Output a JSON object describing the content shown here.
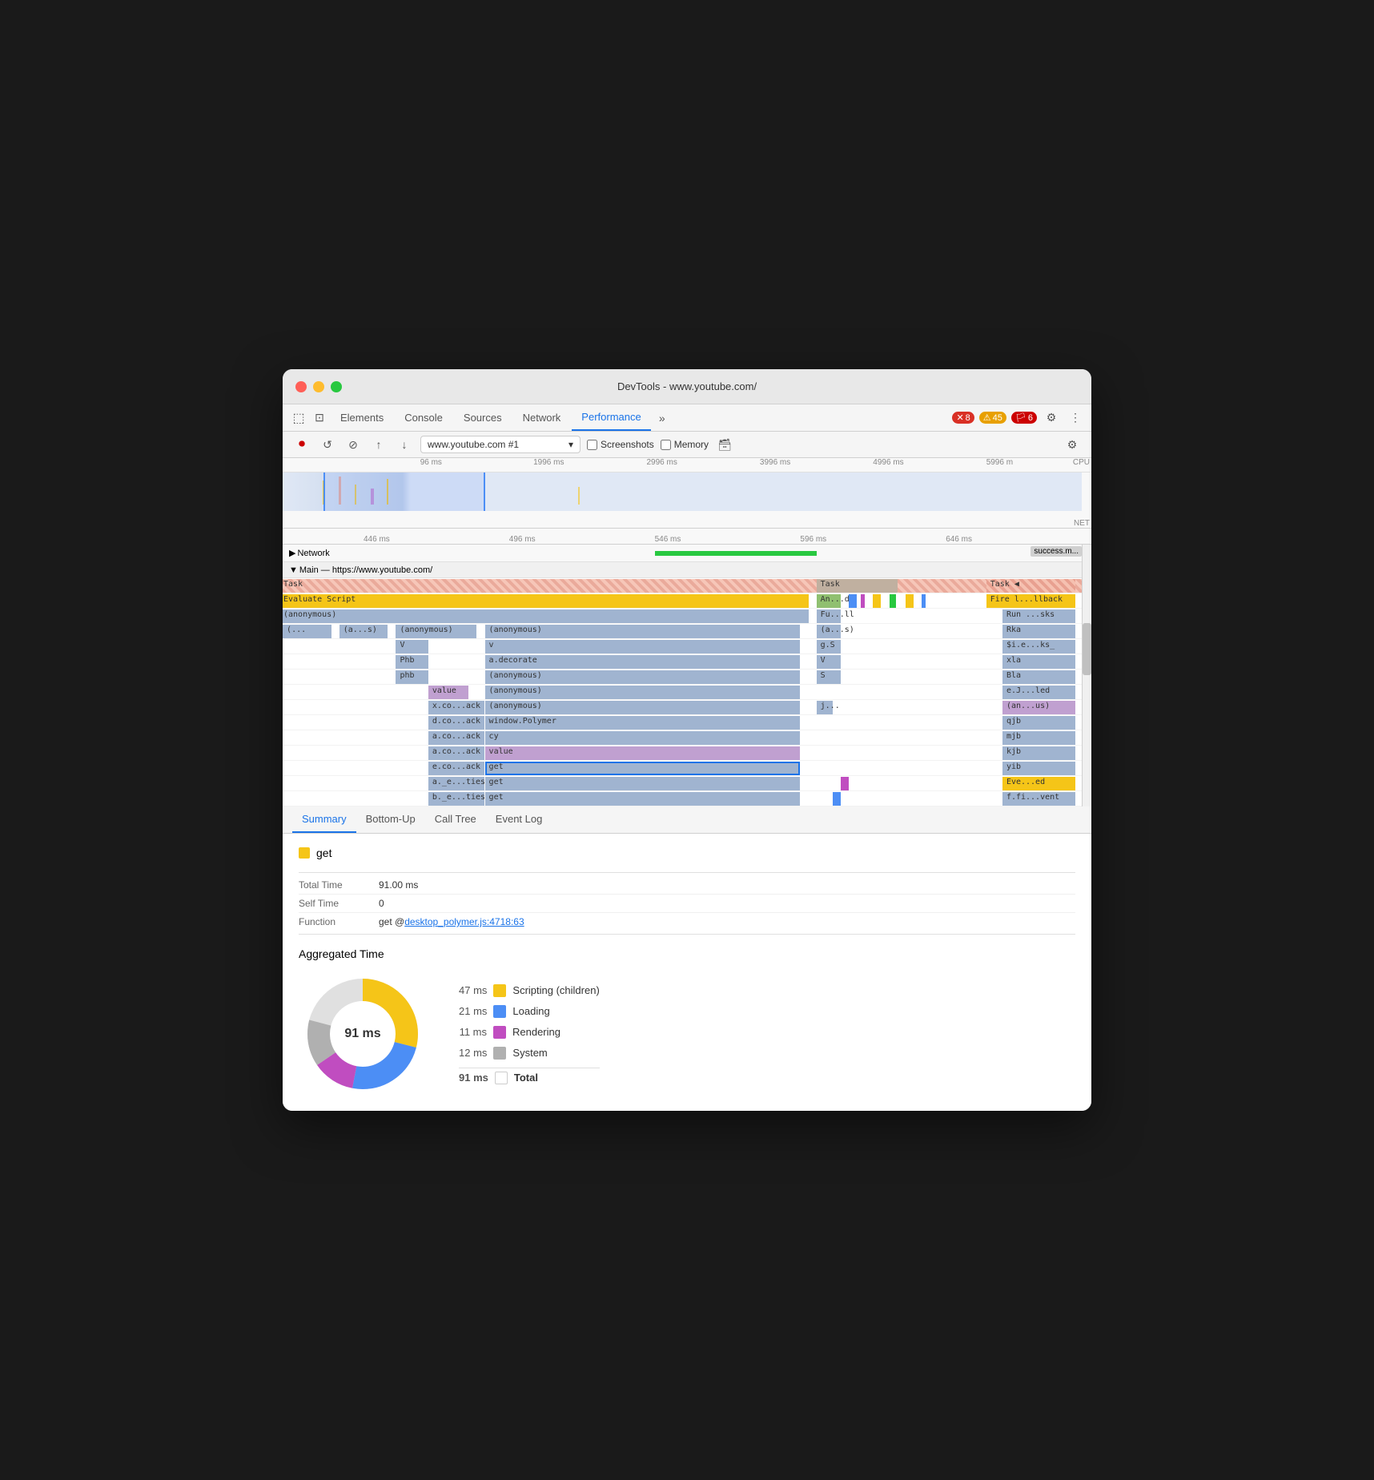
{
  "window": {
    "title": "DevTools - www.youtube.com/"
  },
  "controls": {
    "close": "close",
    "minimize": "minimize",
    "maximize": "maximize"
  },
  "toolbar": {
    "tabs": [
      {
        "label": "Elements",
        "active": false
      },
      {
        "label": "Console",
        "active": false
      },
      {
        "label": "Sources",
        "active": false
      },
      {
        "label": "Network",
        "active": false
      },
      {
        "label": "Performance",
        "active": true
      }
    ],
    "more_label": "»",
    "error_count": "8",
    "warn_count": "45",
    "info_count": "6"
  },
  "address_bar": {
    "url": "www.youtube.com #1",
    "screenshots_label": "Screenshots",
    "memory_label": "Memory"
  },
  "timeline": {
    "rulers": [
      {
        "label": "96 ms",
        "pos": "17%"
      },
      {
        "label": "1996 ms",
        "pos": "31%"
      },
      {
        "label": "2996 ms",
        "pos": "45%"
      },
      {
        "label": "3996 ms",
        "pos": "59%"
      },
      {
        "label": "4996 ms",
        "pos": "73%"
      },
      {
        "label": "5996 m",
        "pos": "87%"
      }
    ],
    "zoom_rulers": [
      {
        "label": "446 ms",
        "pos": "10%"
      },
      {
        "label": "496 ms",
        "pos": "28%"
      },
      {
        "label": "546 ms",
        "pos": "46%"
      },
      {
        "label": "596 ms",
        "pos": "64%"
      },
      {
        "label": "646 ms",
        "pos": "82%"
      }
    ]
  },
  "tracks": [
    {
      "type": "network",
      "label": "▶ Network",
      "expanded": false
    },
    {
      "type": "main",
      "label": "▼ Main — https://www.youtube.com/",
      "expanded": true
    }
  ],
  "flame": {
    "rows": [
      {
        "label": "Task",
        "items": [
          {
            "text": "Task",
            "color": "#e8a090",
            "left": "0%",
            "width": "65%"
          },
          {
            "text": "Task",
            "color": "#c0b0a0",
            "left": "67%",
            "width": "12%"
          },
          {
            "text": "Task",
            "color": "#e8a090",
            "right_text": "◀",
            "left": "87%",
            "width": "12%"
          }
        ]
      },
      {
        "label": "Evaluate Script",
        "items": [
          {
            "text": "Evaluate Script",
            "color": "#f5c518",
            "left": "0%",
            "width": "65%"
          },
          {
            "text": "An...d",
            "color": "#a0c080",
            "left": "66%",
            "width": "4%"
          },
          {
            "text": "Fire l...llback",
            "color": "#f5c518",
            "left": "87%",
            "width": "12%"
          }
        ]
      },
      {
        "label": "(anonymous)",
        "items": [
          {
            "text": "(anonymous)",
            "color": "#a0b4d0",
            "left": "0%",
            "width": "65%"
          },
          {
            "text": "Fu...ll",
            "color": "#a0b4d0",
            "left": "66%",
            "width": "4%"
          },
          {
            "text": "Run ...sks",
            "color": "#a0b4d0",
            "left": "89%",
            "width": "10%"
          }
        ]
      },
      {
        "label": "multi",
        "items": [
          {
            "text": "(...",
            "color": "#a0b4d0",
            "left": "0%",
            "width": "7%"
          },
          {
            "text": "(a...s)",
            "color": "#a0b4d0",
            "left": "8%",
            "width": "7%"
          },
          {
            "text": "(anonymous)",
            "color": "#a0b4d0",
            "left": "16%",
            "width": "12%"
          },
          {
            "text": "(anonymous)",
            "color": "#a0b4d0",
            "left": "29%",
            "width": "35%"
          },
          {
            "text": "(a...s)",
            "color": "#a0b4d0",
            "left": "66%",
            "width": "4%"
          },
          {
            "text": "Rka",
            "color": "#a0b4d0",
            "left": "89%",
            "width": "10%"
          }
        ]
      },
      {
        "label": "",
        "items": [
          {
            "text": "V",
            "color": "#a0b4d0",
            "left": "16%",
            "width": "4%"
          },
          {
            "text": "v",
            "color": "#a0b4d0",
            "left": "29%",
            "width": "35%"
          },
          {
            "text": "g.S",
            "color": "#a0b4d0",
            "left": "66%",
            "width": "4%"
          },
          {
            "text": "$i.e...ks_",
            "color": "#a0b4d0",
            "left": "89%",
            "width": "10%"
          }
        ]
      },
      {
        "label": "",
        "items": [
          {
            "text": "Phb",
            "color": "#a0b4d0",
            "left": "16%",
            "width": "4%"
          },
          {
            "text": "a.decorate",
            "color": "#a0b4d0",
            "left": "29%",
            "width": "35%"
          },
          {
            "text": "V",
            "color": "#a0b4d0",
            "left": "66%",
            "width": "4%"
          },
          {
            "text": "xla",
            "color": "#a0b4d0",
            "left": "89%",
            "width": "10%"
          }
        ]
      },
      {
        "label": "",
        "items": [
          {
            "text": "phb",
            "color": "#a0b4d0",
            "left": "16%",
            "width": "4%"
          },
          {
            "text": "(anonymous)",
            "color": "#a0b4d0",
            "left": "29%",
            "width": "35%"
          },
          {
            "text": "S",
            "color": "#a0b4d0",
            "left": "66%",
            "width": "4%"
          },
          {
            "text": "Bla",
            "color": "#a0b4d0",
            "left": "89%",
            "width": "10%"
          }
        ]
      },
      {
        "label": "",
        "items": [
          {
            "text": "value",
            "color": "#c0a0d0",
            "left": "20%",
            "width": "4%"
          },
          {
            "text": "(anonymous)",
            "color": "#a0b4d0",
            "left": "29%",
            "width": "35%"
          },
          {
            "text": "",
            "color": "",
            "left": "",
            "width": ""
          },
          {
            "text": "e.J...led",
            "color": "#a0b4d0",
            "left": "89%",
            "width": "10%"
          }
        ]
      },
      {
        "label": "",
        "items": [
          {
            "text": "x.co...ack",
            "color": "#a0b4d0",
            "left": "20%",
            "width": "7%"
          },
          {
            "text": "(anonymous)",
            "color": "#a0b4d0",
            "left": "29%",
            "width": "35%"
          },
          {
            "text": "j...",
            "color": "#a0b4d0",
            "left": "66%",
            "width": "3%"
          },
          {
            "text": "(an...us)",
            "color": "#c0a0d0",
            "left": "89%",
            "width": "10%"
          }
        ]
      },
      {
        "label": "",
        "items": [
          {
            "text": "d.co...ack",
            "color": "#a0b4d0",
            "left": "20%",
            "width": "7%"
          },
          {
            "text": "window.Polymer",
            "color": "#a0b4d0",
            "left": "29%",
            "width": "35%"
          },
          {
            "text": "",
            "color": "",
            "left": "",
            "width": ""
          },
          {
            "text": "qjb",
            "color": "#a0b4d0",
            "left": "89%",
            "width": "10%"
          }
        ]
      },
      {
        "label": "",
        "items": [
          {
            "text": "a.co...ack",
            "color": "#a0b4d0",
            "left": "20%",
            "width": "7%"
          },
          {
            "text": "cy",
            "color": "#a0b4d0",
            "left": "29%",
            "width": "35%"
          },
          {
            "text": "",
            "color": "",
            "left": "",
            "width": ""
          },
          {
            "text": "mjb",
            "color": "#a0b4d0",
            "left": "89%",
            "width": "10%"
          }
        ]
      },
      {
        "label": "",
        "items": [
          {
            "text": "a.co...ack",
            "color": "#a0b4d0",
            "left": "20%",
            "width": "7%"
          },
          {
            "text": "value",
            "color": "#c0a0d0",
            "left": "29%",
            "width": "35%"
          },
          {
            "text": "",
            "color": "",
            "left": "",
            "width": ""
          },
          {
            "text": "kjb",
            "color": "#a0b4d0",
            "left": "89%",
            "width": "10%"
          }
        ]
      },
      {
        "label": "",
        "items": [
          {
            "text": "e.co...ack",
            "color": "#a0b4d0",
            "left": "20%",
            "width": "7%"
          },
          {
            "text": "get",
            "color": "#a0b4d0",
            "left": "29%",
            "width": "35%",
            "selected": true
          },
          {
            "text": "",
            "color": "",
            "left": "",
            "width": ""
          },
          {
            "text": "yib",
            "color": "#a0b4d0",
            "left": "89%",
            "width": "10%"
          }
        ]
      },
      {
        "label": "",
        "items": [
          {
            "text": "a._e...ties",
            "color": "#a0b4d0",
            "left": "20%",
            "width": "7%"
          },
          {
            "text": "get",
            "color": "#a0b4d0",
            "left": "29%",
            "width": "35%"
          },
          {
            "text": "",
            "color": "",
            "left": "",
            "width": ""
          },
          {
            "text": "Eve...ed",
            "color": "#f5c518",
            "left": "89%",
            "width": "10%"
          }
        ]
      },
      {
        "label": "",
        "items": [
          {
            "text": "b._e...ties",
            "color": "#a0b4d0",
            "left": "20%",
            "width": "7%"
          },
          {
            "text": "get",
            "color": "#a0b4d0",
            "left": "29%",
            "width": "35%"
          },
          {
            "text": "",
            "color": "",
            "left": "",
            "width": ""
          },
          {
            "text": "f.fi...vent",
            "color": "#a0b4d0",
            "left": "89%",
            "width": "10%"
          }
        ]
      }
    ]
  },
  "bottom_tabs": [
    {
      "label": "Summary",
      "active": true
    },
    {
      "label": "Bottom-Up",
      "active": false
    },
    {
      "label": "Call Tree",
      "active": false
    },
    {
      "label": "Event Log",
      "active": false
    }
  ],
  "summary": {
    "function_name": "get",
    "function_color": "#f5c518",
    "total_time_label": "Total Time",
    "total_time_value": "91.00 ms",
    "self_time_label": "Self Time",
    "self_time_value": "0",
    "function_label": "Function",
    "function_value_prefix": "get @ ",
    "function_link": "desktop_polymer.js:4718:63"
  },
  "aggregated": {
    "title": "Aggregated Time",
    "total_ms": "91 ms",
    "items": [
      {
        "ms": "47 ms",
        "label": "Scripting (children)",
        "color": "#f5c518"
      },
      {
        "ms": "21 ms",
        "label": "Loading",
        "color": "#4c8ef5"
      },
      {
        "ms": "11 ms",
        "label": "Rendering",
        "color": "#c04dc0"
      },
      {
        "ms": "12 ms",
        "label": "System",
        "color": "#b0b0b0"
      }
    ],
    "total_label": "Total",
    "total_value": "91 ms"
  }
}
